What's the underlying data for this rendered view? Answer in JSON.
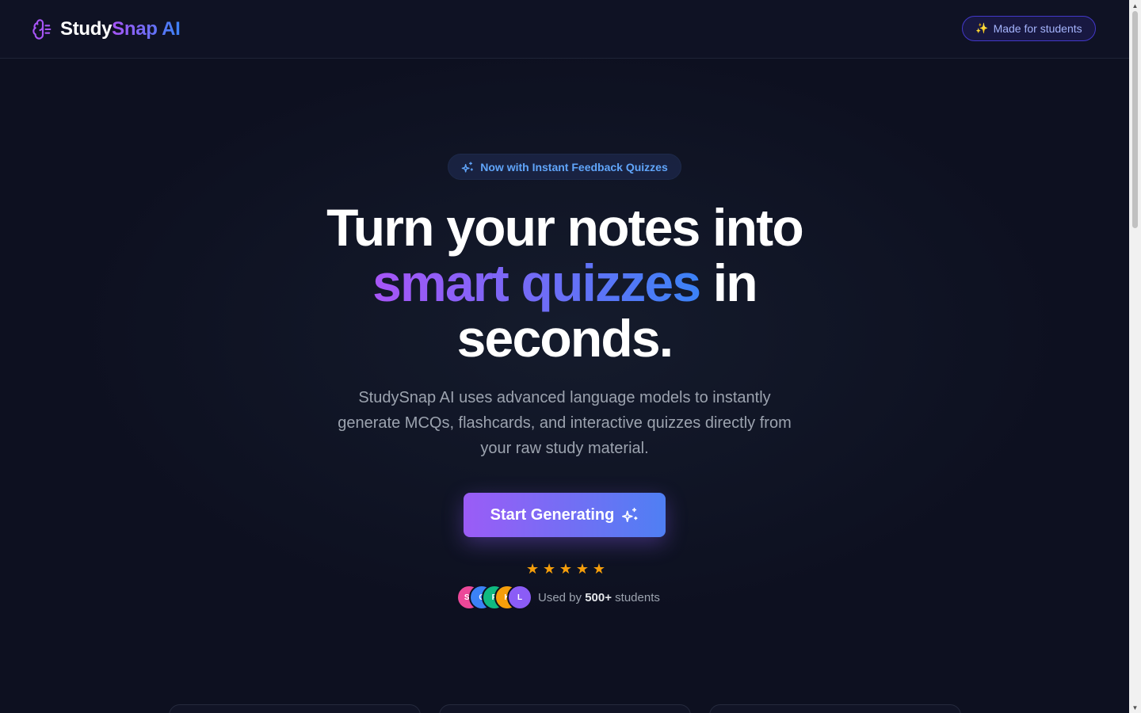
{
  "header": {
    "logo_part1": "Study",
    "logo_part2": "Snap AI",
    "logo_icon": "brain-icon",
    "pill_label": "Made for students",
    "pill_icon": "sparkles-emoji-icon"
  },
  "hero": {
    "badge_label": "Now with Instant Feedback Quizzes",
    "badge_icon": "sparkles-icon",
    "title_line1": "Turn your notes into",
    "title_highlight": "smart quizzes",
    "title_after_highlight": " in",
    "title_line3": "seconds.",
    "subtitle": "StudySnap AI uses advanced language models to instantly generate MCQs, flashcards, and interactive quizzes directly from your raw study material.",
    "cta_label": "Start Generating",
    "cta_icon": "sparkles-icon"
  },
  "social_proof": {
    "rating_stars": 5,
    "avatars": [
      {
        "initials": "SJ",
        "color": "#ec4899"
      },
      {
        "initials": "C",
        "color": "#3b82f6"
      },
      {
        "initials": "P",
        "color": "#10b981"
      },
      {
        "initials": "K",
        "color": "#f59e0b"
      },
      {
        "initials": "L",
        "color": "#8b5cf6"
      }
    ],
    "used_by_prefix": "Used by ",
    "used_by_count": "500+",
    "used_by_suffix": " students"
  },
  "colors": {
    "background": "#0d1020",
    "accent_purple": "#a855f7",
    "accent_blue": "#3b82f6",
    "star": "#f59e0b"
  }
}
